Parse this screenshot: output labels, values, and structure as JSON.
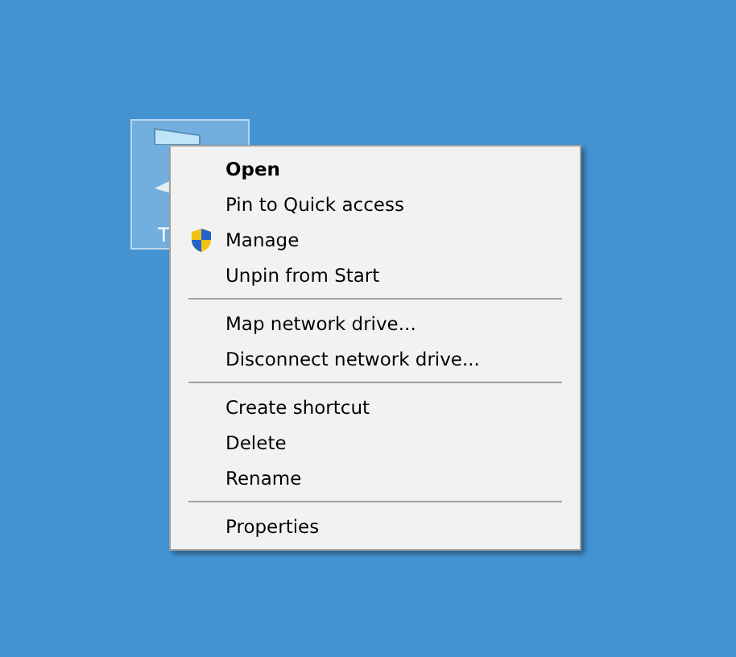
{
  "desktop_icon": {
    "label": "T",
    "selected": true
  },
  "context_menu": {
    "groups": [
      [
        {
          "label": "Open",
          "kind": "default"
        },
        {
          "label": "Pin to Quick access",
          "kind": "plain"
        },
        {
          "label": "Manage",
          "kind": "shield"
        },
        {
          "label": "Unpin from Start",
          "kind": "plain"
        }
      ],
      [
        {
          "label": "Map network drive...",
          "kind": "plain"
        },
        {
          "label": "Disconnect network drive...",
          "kind": "plain"
        }
      ],
      [
        {
          "label": "Create shortcut",
          "kind": "plain"
        },
        {
          "label": "Delete",
          "kind": "plain"
        },
        {
          "label": "Rename",
          "kind": "plain"
        }
      ],
      [
        {
          "label": "Properties",
          "kind": "plain"
        }
      ]
    ]
  }
}
